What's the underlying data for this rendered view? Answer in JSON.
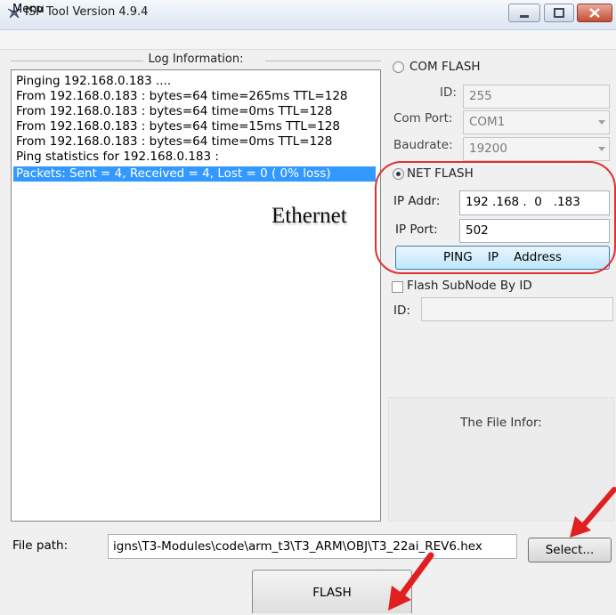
{
  "window": {
    "title": "ISP Tool Version 4.9.4"
  },
  "menu": {
    "label": "Menu"
  },
  "log": {
    "title": "Log Information:",
    "lines": [
      "Pinging 192.168.0.183 ....",
      "From 192.168.0.183 : bytes=64 time=265ms TTL=128",
      "From 192.168.0.183 : bytes=64 time=0ms TTL=128",
      "From 192.168.0.183 : bytes=64 time=15ms TTL=128",
      "From 192.168.0.183 : bytes=64 time=0ms TTL=128",
      "Ping statistics for 192.168.0.183 :",
      "Packets: Sent = 4, Received = 4, Lost = 0 ( 0% loss)"
    ],
    "selected_line_index": 6
  },
  "annotation": {
    "ethernet_label": "Ethernet",
    "highlight_color": "#e03030"
  },
  "com_flash": {
    "label": "COM FLASH",
    "selected": false,
    "id_label": "ID:",
    "id_value": "255",
    "com_port_label": "Com Port:",
    "com_port_value": "COM1",
    "baudrate_label": "Baudrate:",
    "baudrate_value": "19200"
  },
  "net_flash": {
    "label": "NET FLASH",
    "selected": true,
    "ip_addr_label": "IP Addr:",
    "ip_addr_value": "192 .168 .  0   .183",
    "ip_port_label": "IP Port:",
    "ip_port_value": "502",
    "ping_button_label": "PING    IP    Address"
  },
  "subnode": {
    "checkbox_label": "Flash SubNode By ID",
    "checked": false,
    "id_label": "ID:",
    "id_value": ""
  },
  "file_info": {
    "title": "The File Infor:"
  },
  "file_path": {
    "label": "File path:",
    "value": "igns\\T3-Modules\\code\\arm_t3\\T3_ARM\\OBJ\\T3_22ai_REV6.hex"
  },
  "buttons": {
    "select_label": "Select...",
    "flash_label": "FLASH"
  },
  "colors": {
    "selection": "#3399ff",
    "ping_button_border": "#3c7fb1",
    "arrow": "#e02020"
  }
}
